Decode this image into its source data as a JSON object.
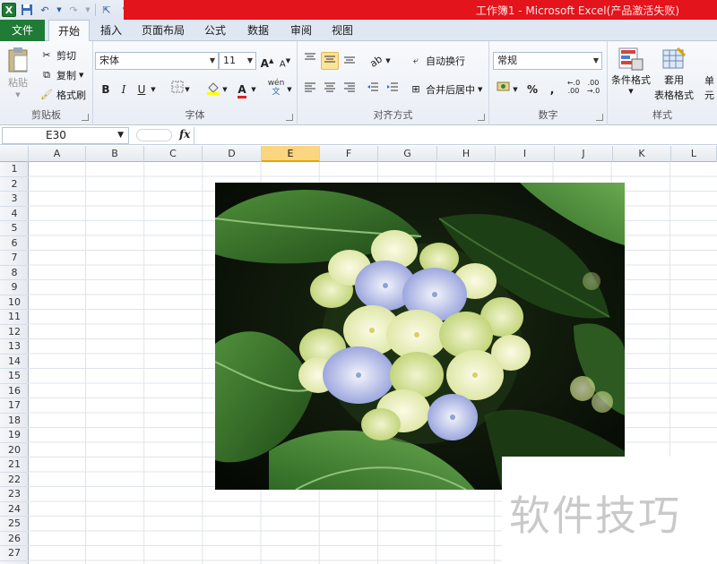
{
  "window": {
    "title": "工作簿1 - Microsoft Excel(产品激活失败)"
  },
  "qat": {
    "app_icon": "X"
  },
  "tabs": {
    "file": "文件",
    "items": [
      "开始",
      "插入",
      "页面布局",
      "公式",
      "数据",
      "审阅",
      "视图"
    ]
  },
  "ribbon": {
    "clipboard": {
      "label": "剪贴板",
      "paste": "粘贴",
      "cut": "剪切",
      "copy": "复制",
      "format_painter": "格式刷"
    },
    "font": {
      "label": "字体",
      "font_name": "宋体",
      "font_size": "11",
      "bold": "B",
      "italic": "I",
      "underline": "U",
      "grow": "A",
      "shrink": "A",
      "font_color": "A",
      "phonetic": "wén"
    },
    "alignment": {
      "label": "对齐方式",
      "wrap_text": "自动换行",
      "merge_center": "合并后居中"
    },
    "number": {
      "label": "数字",
      "format": "常规",
      "percent": "%",
      "comma": ","
    },
    "styles": {
      "label": "样式",
      "conditional": "条件格式",
      "table_line1": "套用",
      "table_line2": "表格格式",
      "cell_styles": "单元"
    }
  },
  "formula_bar": {
    "name_box": "E30",
    "fx": "fx",
    "value": ""
  },
  "grid": {
    "columns": [
      "A",
      "B",
      "C",
      "D",
      "E",
      "F",
      "G",
      "H",
      "I",
      "J",
      "K",
      "L"
    ],
    "selected_column": "E",
    "rows": [
      "1",
      "2",
      "3",
      "4",
      "5",
      "6",
      "7",
      "8",
      "9",
      "10",
      "11",
      "12",
      "13",
      "14",
      "15",
      "16",
      "17",
      "18",
      "19",
      "20",
      "21",
      "22",
      "23",
      "24",
      "25",
      "26",
      "27"
    ]
  },
  "picture": {
    "subject": "hydrangea-flower"
  },
  "watermark": {
    "text": "软件技巧"
  },
  "colors": {
    "title_red": "#e3141b",
    "file_tab_green": "#1f7b36",
    "selected_header": "#fbd580"
  }
}
